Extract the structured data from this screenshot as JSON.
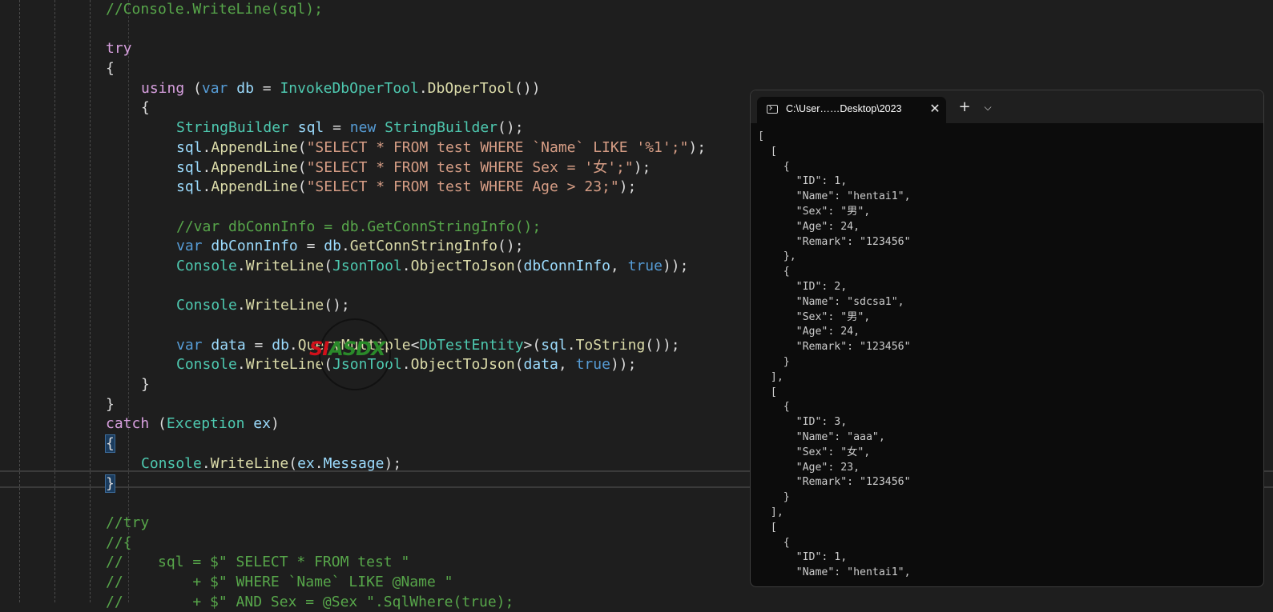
{
  "editor": {
    "lines": [
      [
        [
          "cm",
          "//Console.WriteLine(sql);"
        ]
      ],
      [],
      [
        [
          "ctl",
          "try"
        ]
      ],
      [
        [
          "p",
          "{"
        ]
      ],
      [
        [
          "ctl",
          "using"
        ],
        [
          "p",
          " ("
        ],
        [
          "kw",
          "var"
        ],
        [
          "p",
          " "
        ],
        [
          "vr",
          "db"
        ],
        [
          "p",
          " = "
        ],
        [
          "ty",
          "InvokeDbOperTool"
        ],
        [
          "p",
          "."
        ],
        [
          "fn",
          "DbOperTool"
        ],
        [
          "p",
          "())"
        ]
      ],
      [
        [
          "p",
          "{"
        ]
      ],
      [
        [
          "ty",
          "StringBuilder"
        ],
        [
          "p",
          " "
        ],
        [
          "vr",
          "sql"
        ],
        [
          "p",
          " = "
        ],
        [
          "kw",
          "new"
        ],
        [
          "p",
          " "
        ],
        [
          "ty",
          "StringBuilder"
        ],
        [
          "p",
          "();"
        ]
      ],
      [
        [
          "vr",
          "sql"
        ],
        [
          "p",
          "."
        ],
        [
          "fn",
          "AppendLine"
        ],
        [
          "p",
          "("
        ],
        [
          "st",
          "\"SELECT * FROM test WHERE `Name` LIKE '%1';\""
        ],
        [
          "p",
          ");"
        ]
      ],
      [
        [
          "vr",
          "sql"
        ],
        [
          "p",
          "."
        ],
        [
          "fn",
          "AppendLine"
        ],
        [
          "p",
          "("
        ],
        [
          "st",
          "\"SELECT * FROM test WHERE Sex = '女';\""
        ],
        [
          "p",
          ");"
        ]
      ],
      [
        [
          "vr",
          "sql"
        ],
        [
          "p",
          "."
        ],
        [
          "fn",
          "AppendLine"
        ],
        [
          "p",
          "("
        ],
        [
          "st",
          "\"SELECT * FROM test WHERE Age > 23;\""
        ],
        [
          "p",
          ");"
        ]
      ],
      [],
      [
        [
          "cm",
          "//var dbConnInfo = db.GetConnStringInfo();"
        ]
      ],
      [
        [
          "kw",
          "var"
        ],
        [
          "p",
          " "
        ],
        [
          "vr",
          "dbConnInfo"
        ],
        [
          "p",
          " = "
        ],
        [
          "vr",
          "db"
        ],
        [
          "p",
          "."
        ],
        [
          "fn",
          "GetConnStringInfo"
        ],
        [
          "p",
          "();"
        ]
      ],
      [
        [
          "ty",
          "Console"
        ],
        [
          "p",
          "."
        ],
        [
          "fn",
          "WriteLine"
        ],
        [
          "p",
          "("
        ],
        [
          "ty",
          "JsonTool"
        ],
        [
          "p",
          "."
        ],
        [
          "fn",
          "ObjectToJson"
        ],
        [
          "p",
          "("
        ],
        [
          "vr",
          "dbConnInfo"
        ],
        [
          "p",
          ", "
        ],
        [
          "kw",
          "true"
        ],
        [
          "p",
          "));"
        ]
      ],
      [],
      [
        [
          "ty",
          "Console"
        ],
        [
          "p",
          "."
        ],
        [
          "fn",
          "WriteLine"
        ],
        [
          "p",
          "();"
        ]
      ],
      [],
      [
        [
          "kw",
          "var"
        ],
        [
          "p",
          " "
        ],
        [
          "vr",
          "data"
        ],
        [
          "p",
          " = "
        ],
        [
          "vr",
          "db"
        ],
        [
          "p",
          "."
        ],
        [
          "fn",
          "QueryMultiple"
        ],
        [
          "p",
          "<"
        ],
        [
          "ty",
          "DbTestEntity"
        ],
        [
          "p",
          ">("
        ],
        [
          "vr",
          "sql"
        ],
        [
          "p",
          "."
        ],
        [
          "fn",
          "ToString"
        ],
        [
          "p",
          "());"
        ]
      ],
      [
        [
          "ty",
          "Console"
        ],
        [
          "p",
          "."
        ],
        [
          "fn",
          "WriteLine"
        ],
        [
          "p",
          "("
        ],
        [
          "ty",
          "JsonTool"
        ],
        [
          "p",
          "."
        ],
        [
          "fn",
          "ObjectToJson"
        ],
        [
          "p",
          "("
        ],
        [
          "vr",
          "data"
        ],
        [
          "p",
          ", "
        ],
        [
          "kw",
          "true"
        ],
        [
          "p",
          "));"
        ]
      ],
      [
        [
          "p",
          "}"
        ]
      ],
      [
        [
          "p",
          "}"
        ]
      ],
      [
        [
          "ctl",
          "catch"
        ],
        [
          "p",
          " ("
        ],
        [
          "ty",
          "Exception"
        ],
        [
          "p",
          " "
        ],
        [
          "vr",
          "ex"
        ],
        [
          "p",
          ")"
        ]
      ],
      [
        [
          "brhl",
          "{"
        ]
      ],
      [
        [
          "ty",
          "Console"
        ],
        [
          "p",
          "."
        ],
        [
          "fn",
          "WriteLine"
        ],
        [
          "p",
          "("
        ],
        [
          "vr",
          "ex"
        ],
        [
          "p",
          "."
        ],
        [
          "vr",
          "Message"
        ],
        [
          "p",
          ");"
        ]
      ],
      [
        [
          "brhl",
          "}"
        ]
      ],
      [],
      [
        [
          "cm",
          "//try"
        ]
      ],
      [
        [
          "cm",
          "//{"
        ]
      ],
      [
        [
          "cm",
          "//    sql = $\" SELECT * FROM test \""
        ]
      ],
      [
        [
          "cm",
          "//        + $\" WHERE `Name` LIKE @Name \""
        ]
      ],
      [
        [
          "cm",
          "//        + $\" AND Sex = @Sex \".SqlWhere(true);"
        ]
      ]
    ],
    "indents": [
      3,
      0,
      3,
      3,
      4,
      4,
      5,
      5,
      5,
      5,
      0,
      5,
      5,
      5,
      0,
      5,
      0,
      5,
      5,
      4,
      3,
      3,
      3,
      4,
      3,
      0,
      3,
      3,
      3,
      3,
      3
    ]
  },
  "watermark": {
    "part1": "SI",
    "part2": "ASDX"
  },
  "terminal": {
    "tab_title": "C:\\User……Desktop\\2023",
    "close_glyph": "✕",
    "new_tab_glyph": "+",
    "dropdown_glyph": "⌵",
    "output": [
      "[",
      "  [",
      "    {",
      "      \"ID\": 1,",
      "      \"Name\": \"hentai1\",",
      "      \"Sex\": \"男\",",
      "      \"Age\": 24,",
      "      \"Remark\": \"123456\"",
      "    },",
      "    {",
      "      \"ID\": 2,",
      "      \"Name\": \"sdcsa1\",",
      "      \"Sex\": \"男\",",
      "      \"Age\": 24,",
      "      \"Remark\": \"123456\"",
      "    }",
      "  ],",
      "  [",
      "    {",
      "      \"ID\": 3,",
      "      \"Name\": \"aaa\",",
      "      \"Sex\": \"女\",",
      "      \"Age\": 23,",
      "      \"Remark\": \"123456\"",
      "    }",
      "  ],",
      "  [",
      "    {",
      "      \"ID\": 1,",
      "      \"Name\": \"hentai1\","
    ]
  }
}
